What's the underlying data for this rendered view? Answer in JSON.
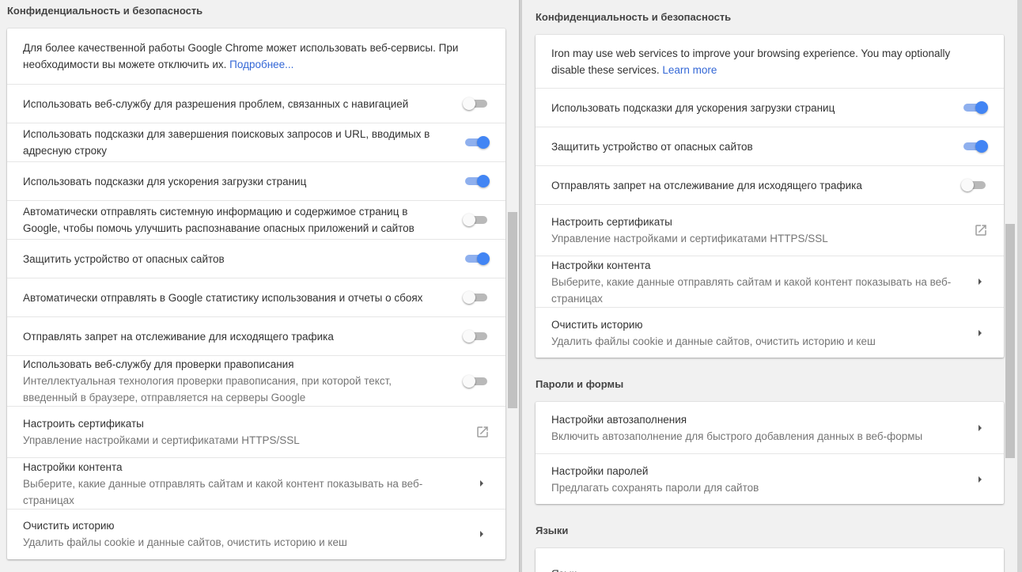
{
  "left": {
    "section_title": "Конфиденциальность и безопасность",
    "intro": {
      "text": "Для более качественной работы Google Chrome может использовать веб-сервисы. При необходимости вы можете отключить их.",
      "link": "Подробнее..."
    },
    "toggles": [
      {
        "label": "Использовать веб-службу для разрешения проблем, связанных с навигацией",
        "on": false
      },
      {
        "label": "Использовать подсказки для завершения поисковых запросов и URL, вводимых в адресную строку",
        "on": true
      },
      {
        "label": "Использовать подсказки для ускорения загрузки страниц",
        "on": true
      },
      {
        "label": "Автоматически отправлять системную информацию и содержимое страниц в Google, чтобы помочь улучшить распознавание опасных приложений и сайтов",
        "on": false
      },
      {
        "label": "Защитить устройство от опасных сайтов",
        "on": true
      },
      {
        "label": "Автоматически отправлять в Google статистику использования и отчеты о сбоях",
        "on": false
      },
      {
        "label": "Отправлять запрет на отслеживание для исходящего трафика",
        "on": false
      }
    ],
    "spellcheck": {
      "title": "Использовать веб-службу для проверки правописания",
      "desc": "Интеллектуальная технология проверки правописания, при которой текст, введенный в браузере, отправляется на серверы Google",
      "on": false
    },
    "certificates": {
      "title": "Настроить сертификаты",
      "desc": "Управление настройками и сертификатами HTTPS/SSL"
    },
    "content": {
      "title": "Настройки контента",
      "desc": "Выберите, какие данные отправлять сайтам и какой контент показывать на веб-страницах"
    },
    "clear_history": {
      "title": "Очистить историю",
      "desc": "Удалить файлы cookie и данные сайтов, очистить историю и кеш"
    }
  },
  "right": {
    "section_title": "Конфиденциальность и безопасность",
    "intro": {
      "text": "Iron may use web services to improve your browsing experience. You may optionally disable these services.",
      "link": "Learn more"
    },
    "toggles": [
      {
        "label": "Использовать подсказки для ускорения загрузки страниц",
        "on": true
      },
      {
        "label": "Защитить устройство от опасных сайтов",
        "on": true
      },
      {
        "label": "Отправлять запрет на отслеживание для исходящего трафика",
        "on": false
      }
    ],
    "certificates": {
      "title": "Настроить сертификаты",
      "desc": "Управление настройками и сертификатами HTTPS/SSL"
    },
    "content": {
      "title": "Настройки контента",
      "desc": "Выберите, какие данные отправлять сайтам и какой контент показывать на веб-страницах"
    },
    "clear_history": {
      "title": "Очистить историю",
      "desc": "Удалить файлы cookie и данные сайтов, очистить историю и кеш"
    },
    "passwords_title": "Пароли и формы",
    "autofill": {
      "title": "Настройки автозаполнения",
      "desc": "Включить автозаполнение для быстрого добавления данных в веб-формы"
    },
    "passwords": {
      "title": "Настройки паролей",
      "desc": "Предлагать сохранять пароли для сайтов"
    },
    "languages_title": "Языки",
    "languages_row": "Язык"
  },
  "colors": {
    "accent": "#4285f4",
    "link": "#3367d6",
    "toggle_off": "#b9b9b9"
  },
  "icons": [
    "external-link-icon",
    "chevron-right-icon"
  ]
}
